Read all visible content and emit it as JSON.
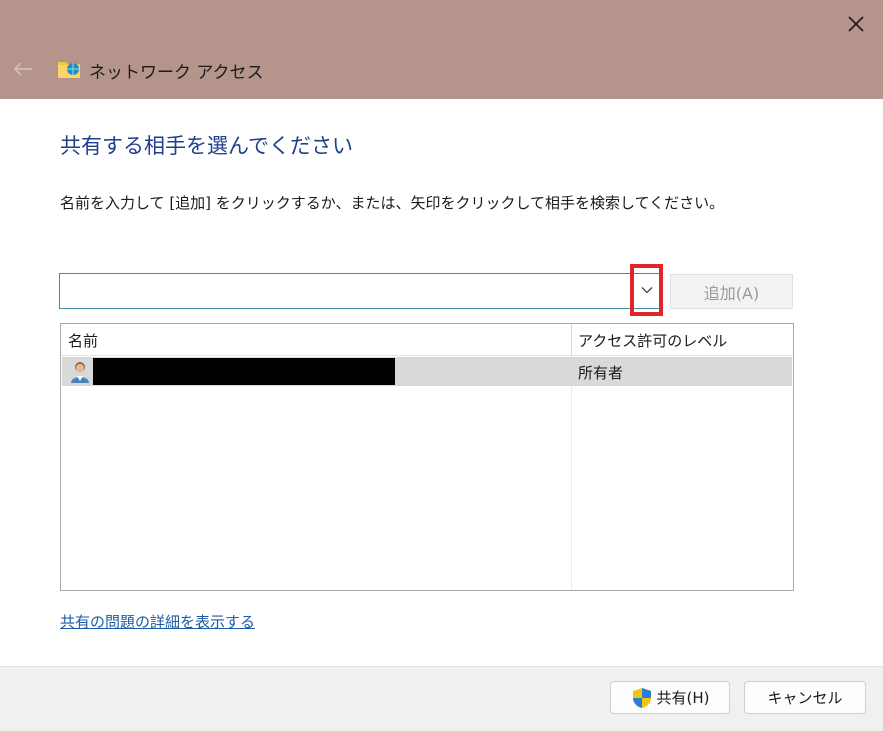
{
  "window": {
    "title": "ネットワーク アクセス",
    "close_icon": "close-icon",
    "back_icon": "back-arrow-icon"
  },
  "main": {
    "heading": "共有する相手を選んでください",
    "instruction": "名前を入力して [追加] をクリックするか、または、矢印をクリックして相手を検索してください。",
    "name_input": {
      "value": "",
      "placeholder": ""
    },
    "add_button": "追加(A)"
  },
  "list": {
    "columns": [
      "名前",
      "アクセス許可のレベル"
    ],
    "rows": [
      {
        "name": "",
        "level": "所有者"
      }
    ]
  },
  "help_link": "共有の問題の詳細を表示する",
  "footer": {
    "share_button": "共有(H)",
    "cancel_button": "キャンセル"
  },
  "colors": {
    "titlebar": "#b5958b",
    "heading": "#1e3f8c",
    "link": "#1b5ca8",
    "highlight_box": "#e0262b"
  }
}
